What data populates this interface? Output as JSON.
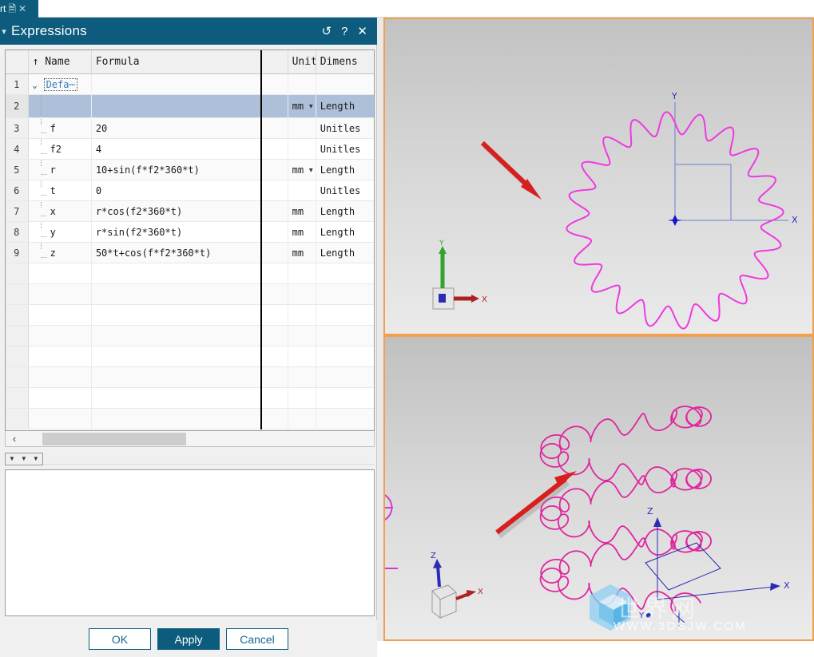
{
  "tab": {
    "label": "rt",
    "doc_icon": "document-icon",
    "close_icon": "close-icon"
  },
  "dialog": {
    "title": "Expressions",
    "title_buttons": [
      {
        "name": "reset-icon",
        "glyph": "↺"
      },
      {
        "name": "help-icon",
        "glyph": "?"
      },
      {
        "name": "close-icon",
        "glyph": "✕"
      }
    ],
    "table": {
      "headers": [
        "",
        "↑ Name",
        "Formula",
        "",
        "Units",
        "Dimens"
      ],
      "rows": [
        {
          "num": "1",
          "name": "Defa⋯",
          "formula": "",
          "units": "",
          "dim": "",
          "type": "group",
          "selected": false,
          "units_dropdown": false
        },
        {
          "num": "2",
          "name": "",
          "formula": "",
          "units": "mm",
          "dim": "Length",
          "type": "child",
          "selected": true,
          "units_dropdown": true
        },
        {
          "num": "3",
          "name": "f",
          "formula": "20",
          "units": "",
          "dim": "Unitles",
          "type": "child",
          "selected": false,
          "units_dropdown": false
        },
        {
          "num": "4",
          "name": "f2",
          "formula": "4",
          "units": "",
          "dim": "Unitles",
          "type": "child",
          "selected": false,
          "units_dropdown": false
        },
        {
          "num": "5",
          "name": "r",
          "formula": "10+sin(f*f2*360*t)",
          "units": "mm",
          "dim": "Length",
          "type": "child",
          "selected": false,
          "units_dropdown": true
        },
        {
          "num": "6",
          "name": "t",
          "formula": "0",
          "units": "",
          "dim": "Unitles",
          "type": "child",
          "selected": false,
          "units_dropdown": false
        },
        {
          "num": "7",
          "name": "x",
          "formula": "r*cos(f2*360*t)",
          "units": "mm",
          "dim": "Length",
          "type": "child",
          "selected": false,
          "units_dropdown": false
        },
        {
          "num": "8",
          "name": "y",
          "formula": "r*sin(f2*360*t)",
          "units": "mm",
          "dim": "Length",
          "type": "child",
          "selected": false,
          "units_dropdown": false
        },
        {
          "num": "9",
          "name": "z",
          "formula": "50*t+cos(f*f2*360*t)",
          "units": "mm",
          "dim": "Length",
          "type": "child",
          "selected": false,
          "units_dropdown": false
        }
      ],
      "empty_row_count": 8
    },
    "scrollbar": {
      "left_arrow": "‹"
    },
    "minitoolbar": {
      "buttons": [
        "dropdown-arrow-1",
        "dropdown-arrow-2",
        "dropdown-arrow-3"
      ],
      "glyph": "▼"
    },
    "footer": {
      "ok_label": "OK",
      "apply_label": "Apply",
      "cancel_label": "Cancel"
    }
  },
  "viewports": {
    "top": {
      "name": "top-viewport",
      "triad": {
        "y_label": "Y",
        "x_label": "X"
      },
      "axes": {
        "y_label": "Y",
        "x_label": "X"
      },
      "curve_color": "#ee3ae0",
      "annotation_arrow": "red-arrow"
    },
    "bottom": {
      "name": "bottom-viewport",
      "triad": {
        "z_label": "Z",
        "x_label": "X"
      },
      "axes": {
        "z_label": "Z",
        "x_label": "X",
        "y_label": "Y"
      },
      "curve_color": "#e0259f",
      "annotation_arrow": "red-arrow"
    },
    "watermark": {
      "cn": "世界网",
      "url": "WWW.3DSJW.COM"
    }
  },
  "colors": {
    "accent_blue": "#0d5c7e",
    "viewport_border": "#f2a04c",
    "selection": "#aec0d9",
    "curve_magenta": "#ee3ae0",
    "arrow_red": "#e01b1b"
  }
}
